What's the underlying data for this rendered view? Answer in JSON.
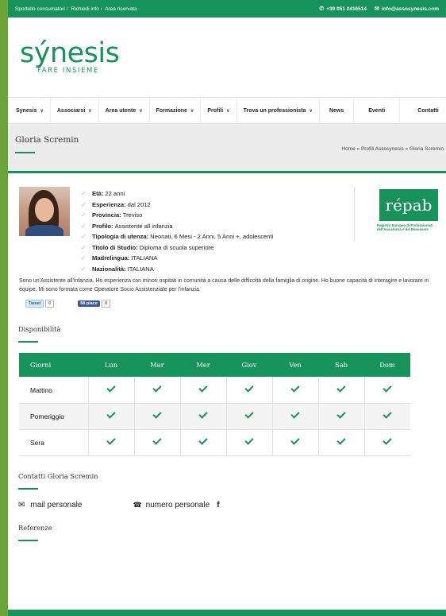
{
  "topbar": {
    "links": [
      "Sportello consumatori",
      "Richiedi info",
      "Area riservata"
    ],
    "phone": "+39 051 0416514",
    "email": "info@assosynesis.com"
  },
  "logo": {
    "word": "sýnesis",
    "tagline": "FARE INSIEME"
  },
  "nav": [
    {
      "label": "Synesis",
      "dropdown": true
    },
    {
      "label": "Associarsi",
      "dropdown": true
    },
    {
      "label": "Area utente",
      "dropdown": true
    },
    {
      "label": "Formazione",
      "dropdown": true
    },
    {
      "label": "Profili",
      "dropdown": true
    },
    {
      "label": "Trova un professionista",
      "dropdown": true
    },
    {
      "label": "News",
      "dropdown": false
    },
    {
      "label": "Eventi",
      "dropdown": false
    },
    {
      "label": "Contatti",
      "dropdown": false
    }
  ],
  "page": {
    "title": "Gloria Scremin",
    "breadcrumb": "Home » Profili Assosynesis » Gloria Scremin"
  },
  "profile": {
    "facts": [
      {
        "label": "Età:",
        "value": "22 anni"
      },
      {
        "label": "Esperienza:",
        "value": "dal 2012"
      },
      {
        "label": "Provincia:",
        "value": "Treviso"
      },
      {
        "label": "Profilo:",
        "value": "Assistente all infanzia"
      },
      {
        "label": "Tipologia di utenza:",
        "value": "Neonati, 6 Mesi - 2 Anni, 5 Anni +, adolescenti"
      },
      {
        "label": "Titolo di Studio:",
        "value": "Diploma di scuola superiore"
      },
      {
        "label": "Madrelingua:",
        "value": "ITALIANA"
      },
      {
        "label": "Nazionalità:",
        "value": "ITALIANA"
      }
    ],
    "description": "Sono un'Assistente all'infanzia. Ho esperienza con minori ospitati in comunità a causa delle difficoltà della famiglia di origine.  Ho buone capacità di interagire e lavorare in équipe. Mi sono formata come Operatore Socio Assistenziale per l'infanzia."
  },
  "badge": {
    "name": "répab",
    "caption": "Registro Europeo di Professionisti dell'Assistenza e del Benessere"
  },
  "social": {
    "tweet_label": "Tweet",
    "tweet_count": "0",
    "like_label": "Mi piace",
    "like_count": "0"
  },
  "availability": {
    "heading": "Disponibilità",
    "columns": [
      "Giorni",
      "Lun",
      "Mar",
      "Mer",
      "Giov",
      "Ven",
      "Sab",
      "Dom"
    ],
    "rows": [
      {
        "label": "Mattino",
        "slots": [
          true,
          true,
          true,
          true,
          true,
          true,
          true
        ]
      },
      {
        "label": "Pomeriggio",
        "slots": [
          true,
          true,
          true,
          true,
          true,
          true,
          true
        ]
      },
      {
        "label": "Sera",
        "slots": [
          true,
          true,
          true,
          true,
          true,
          true,
          true
        ]
      }
    ]
  },
  "contacts": {
    "heading": "Contatti Gloria Scremin",
    "mail": "mail personale",
    "phone": "numero personale",
    "fb": "f"
  },
  "references": {
    "heading": "Referenze"
  },
  "colors": {
    "brand": "#17925b",
    "band": "#ececec"
  }
}
